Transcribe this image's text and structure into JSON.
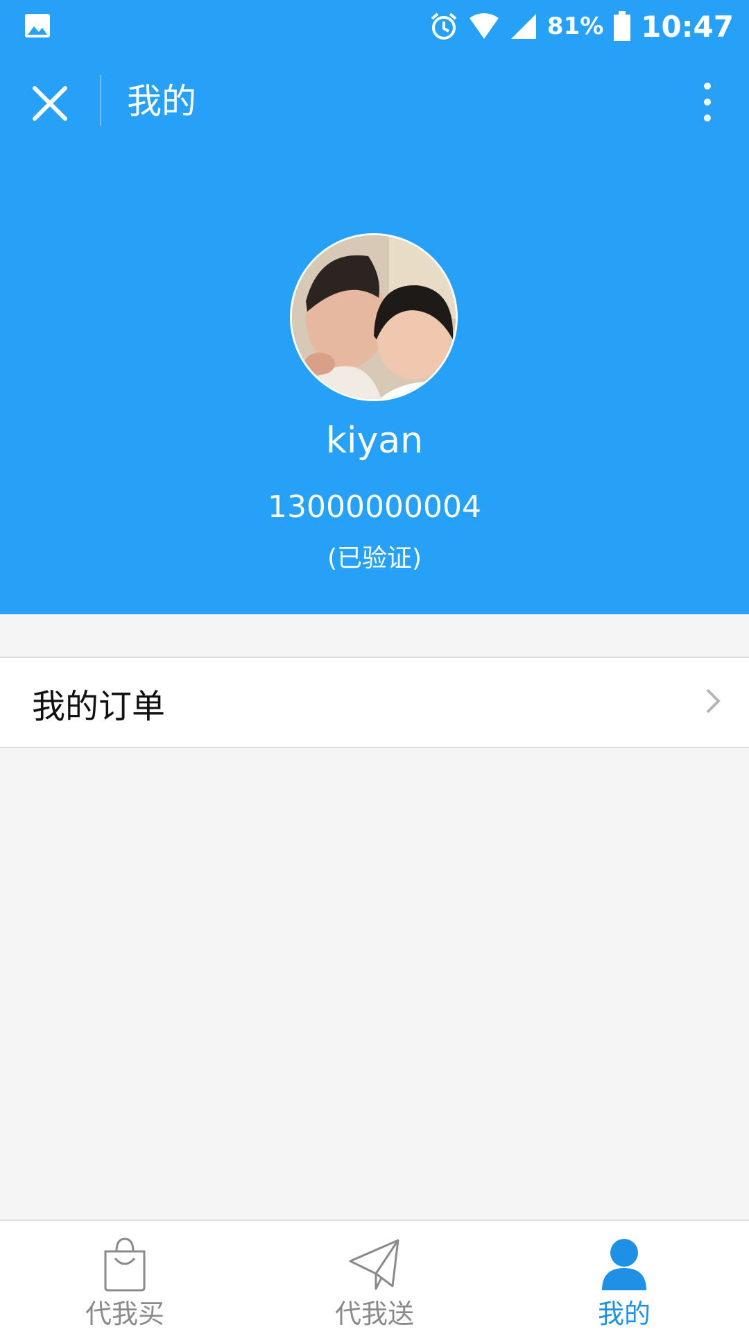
{
  "status_bar": {
    "battery": "81%",
    "time": "10:47"
  },
  "toolbar": {
    "title": "我的"
  },
  "profile": {
    "username": "kiyan",
    "phone": "13000000004",
    "verification": "(已验证)"
  },
  "menu": {
    "orders_label": "我的订单"
  },
  "bottom_nav": {
    "items": [
      {
        "label": "代我买",
        "icon": "shopping-bag-icon"
      },
      {
        "label": "代我送",
        "icon": "paper-plane-icon"
      },
      {
        "label": "我的",
        "icon": "person-icon",
        "active": true
      }
    ]
  },
  "colors": {
    "primary": "#27a0f7",
    "nav_active": "#1e90e5",
    "nav_inactive": "#8a8a8a",
    "background": "#f5f5f5"
  }
}
